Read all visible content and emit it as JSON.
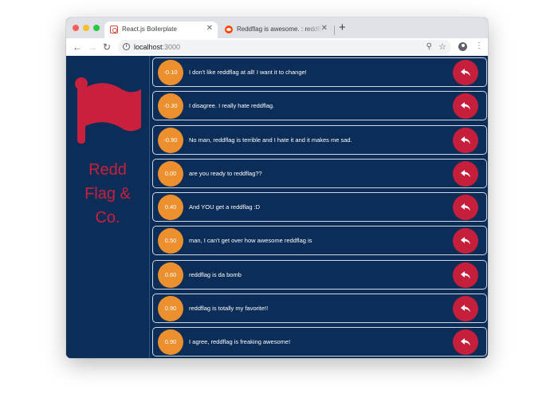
{
  "browser": {
    "tabs": [
      {
        "title": "React.js Boilerplate",
        "active": true,
        "favicon": "react-boilerplate-icon"
      },
      {
        "title": "Reddflag is awesome. : reddfla",
        "active": false,
        "favicon": "reddit-icon"
      }
    ],
    "url": {
      "host": "localhost",
      "port": ":3000"
    }
  },
  "sidebar": {
    "logo_icon": "red-flag-icon",
    "brand": "Redd\nFlag &\nCo."
  },
  "colors": {
    "background": "#0b2d57",
    "score": "#ec8f2e",
    "reply": "#c51f3c",
    "brand": "#c9203e"
  },
  "messages": [
    {
      "score": "-0.10",
      "text": "I don't like reddflag at all! I want it to change!"
    },
    {
      "score": "-0.30",
      "text": "I disagree. I really hate reddflag."
    },
    {
      "score": "-0.90",
      "text": "No man, reddflag is terrible and I hate it and it makes me sad."
    },
    {
      "score": "0.00",
      "text": "are you ready to reddflag??"
    },
    {
      "score": "0.40",
      "text": "And YOU get a reddflag :D"
    },
    {
      "score": "0.50",
      "text": "man, I can't get over how awesome reddflag is"
    },
    {
      "score": "0.60",
      "text": "reddflag is da bomb"
    },
    {
      "score": "0.90",
      "text": "reddflag is totally my favorite!!"
    },
    {
      "score": "0.90",
      "text": "I agree, reddflag is freaking awesome!"
    }
  ]
}
